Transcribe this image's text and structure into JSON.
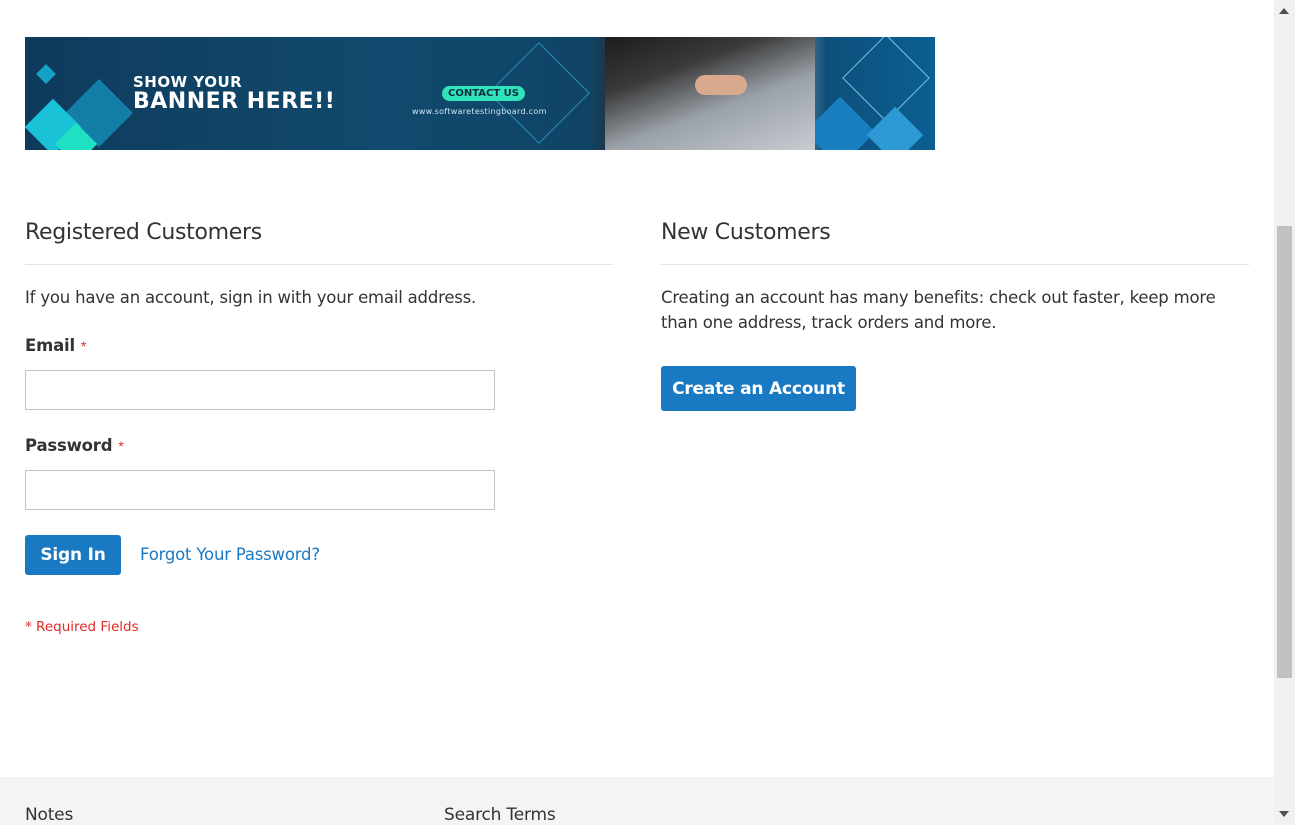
{
  "banner": {
    "line1": "SHOW YOUR",
    "line2": "BANNER HERE!!",
    "contact_label": "CONTACT US",
    "site": "www.softwaretestingboard.com"
  },
  "login": {
    "title": "Registered Customers",
    "intro": "If you have an account, sign in with your email address.",
    "email_label": "Email",
    "password_label": "Password",
    "required_star": "*",
    "sign_in_label": "Sign In",
    "forgot_label": "Forgot Your Password?",
    "required_note": "* Required Fields"
  },
  "register": {
    "title": "New Customers",
    "intro": "Creating an account has many benefits: check out faster, keep more than one address, track orders and more.",
    "create_label": "Create an Account"
  },
  "footer": {
    "links": [
      "Notes",
      "Search Terms"
    ]
  },
  "colors": {
    "primary": "#1979c3",
    "required": "#e02b27"
  }
}
